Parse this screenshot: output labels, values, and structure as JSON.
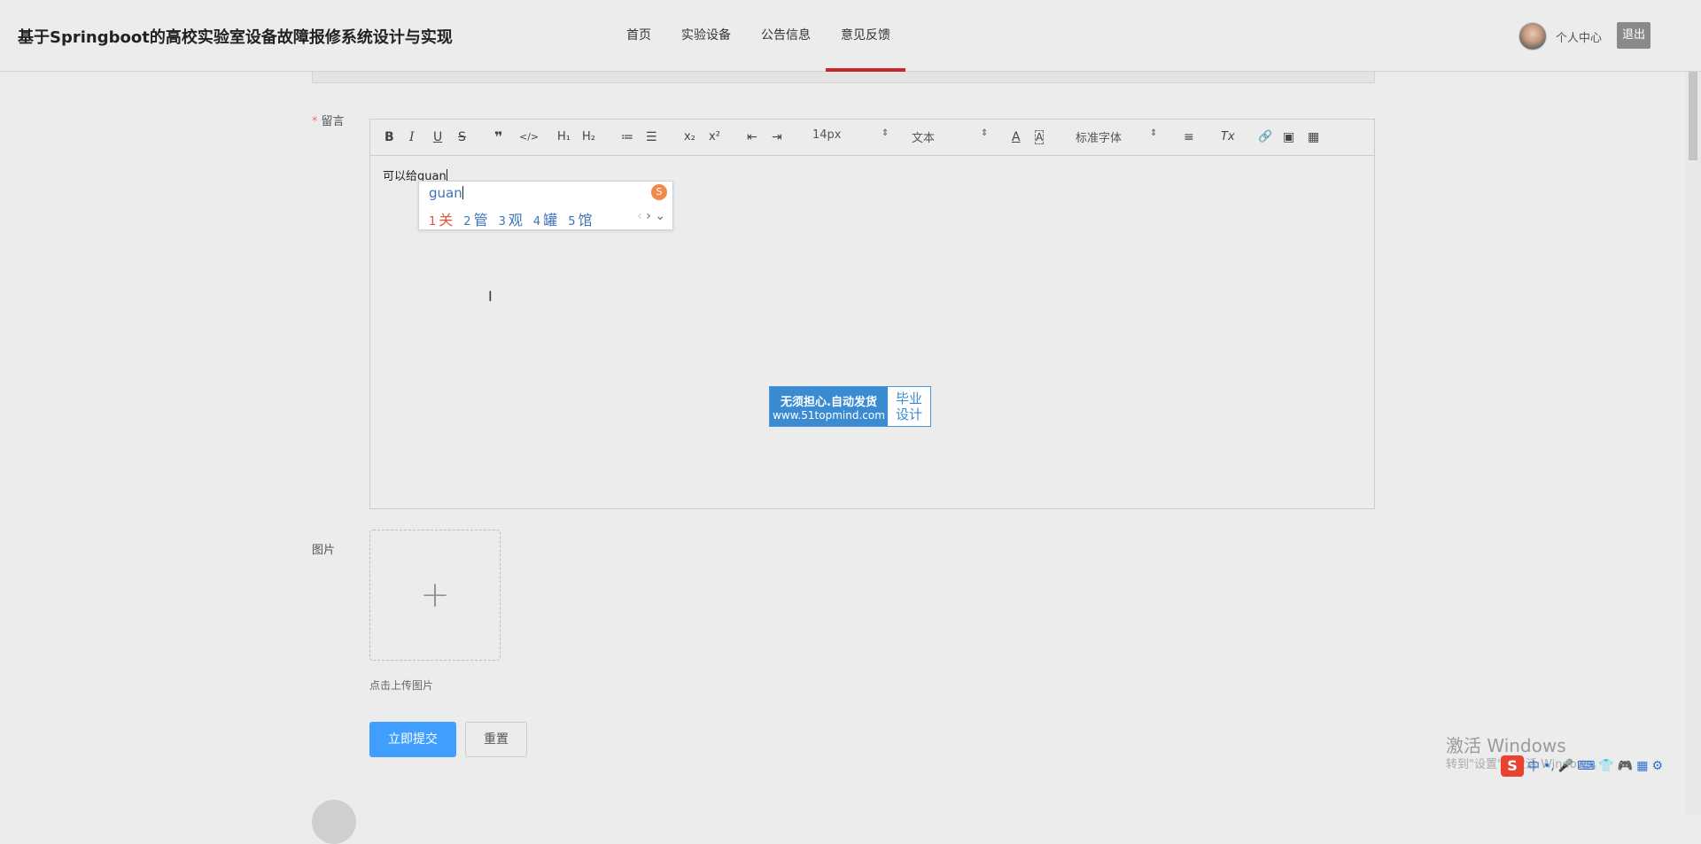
{
  "header": {
    "site_title": "基于Springboot的高校实验室设备故障报修系统设计与实现",
    "nav": [
      {
        "label": "首页",
        "active": false
      },
      {
        "label": "实验设备",
        "active": false
      },
      {
        "label": "公告信息",
        "active": false
      },
      {
        "label": "意见反馈",
        "active": true
      }
    ],
    "user_center": "个人中心",
    "logout": "退出"
  },
  "form": {
    "message_label": "留言",
    "required_mark": "*",
    "image_label": "图片",
    "upload_hint": "点击上传图片",
    "upload_plus": "+",
    "submit": "立即提交",
    "reset": "重置"
  },
  "editor": {
    "toolbar": {
      "bold": "B",
      "italic": "I",
      "underline": "U",
      "strike": "S",
      "blockquote": "❞",
      "code": "</>",
      "h1": "H₁",
      "h2": "H₂",
      "ordered_list": "≔",
      "bullet_list": "☰",
      "subscript": "x₂",
      "superscript": "x²",
      "outdent": "⇤",
      "indent": "⇥",
      "font_size": "14px",
      "text_type": "文本",
      "font_family": "标准字体",
      "font_color": "A",
      "background_color": "A",
      "align": "≡",
      "clean": "Tx",
      "link": "🔗",
      "image": "▣",
      "video": "▦",
      "select_arrow": "⇕"
    },
    "content": "可以给guan"
  },
  "ime": {
    "input": "guan",
    "logo": "S",
    "candidates": [
      {
        "num": "1",
        "text": "关"
      },
      {
        "num": "2",
        "text": "管"
      },
      {
        "num": "3",
        "text": "观"
      },
      {
        "num": "4",
        "text": "罐"
      },
      {
        "num": "5",
        "text": "馆"
      }
    ],
    "prev": "‹",
    "next": "›",
    "more": "⌄"
  },
  "mouse_cursor": "I",
  "watermark": {
    "line1": "无须担心.自动发货",
    "line2": "www.51topmind.com",
    "right1": "毕业",
    "right2": "设计"
  },
  "windows": {
    "activate": "激活 Windows",
    "activate_sub": "转到\"设置\"以激活 Windows。"
  },
  "tray": {
    "sogou": "S",
    "lang": "中",
    "punct": "•,",
    "mic": "🎤",
    "keyboard": "⌨",
    "shirt": "👕",
    "game": "🎮",
    "grid": "▦",
    "gear": "⚙"
  },
  "icons": {
    "avatar": "avatar",
    "upload": "plus-icon"
  }
}
